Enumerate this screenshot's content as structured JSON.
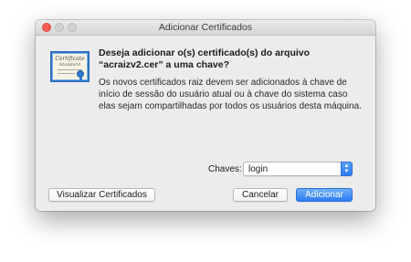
{
  "window": {
    "title": "Adicionar Certificados"
  },
  "icon": {
    "name": "certificate-icon",
    "text_line1": "Certificate",
    "text_line2": "Standard"
  },
  "dialog": {
    "heading": "Deseja adicionar o(s) certificado(s) do arquivo “acraizv2.cer” a uma chave?",
    "message": "Os novos certificados raiz devem ser adicionados à chave de início de sessão do usuário atual ou à chave do sistema caso elas sejam compartilhadas por todos os usuários desta máquina."
  },
  "keychain": {
    "label": "Chaves:",
    "selected": "login"
  },
  "buttons": {
    "view": "Visualizar Certificados",
    "cancel": "Cancelar",
    "add": "Adicionar"
  },
  "colors": {
    "accent": "#2d7cf2",
    "close": "#fc5f57",
    "window_bg": "#ececec"
  }
}
